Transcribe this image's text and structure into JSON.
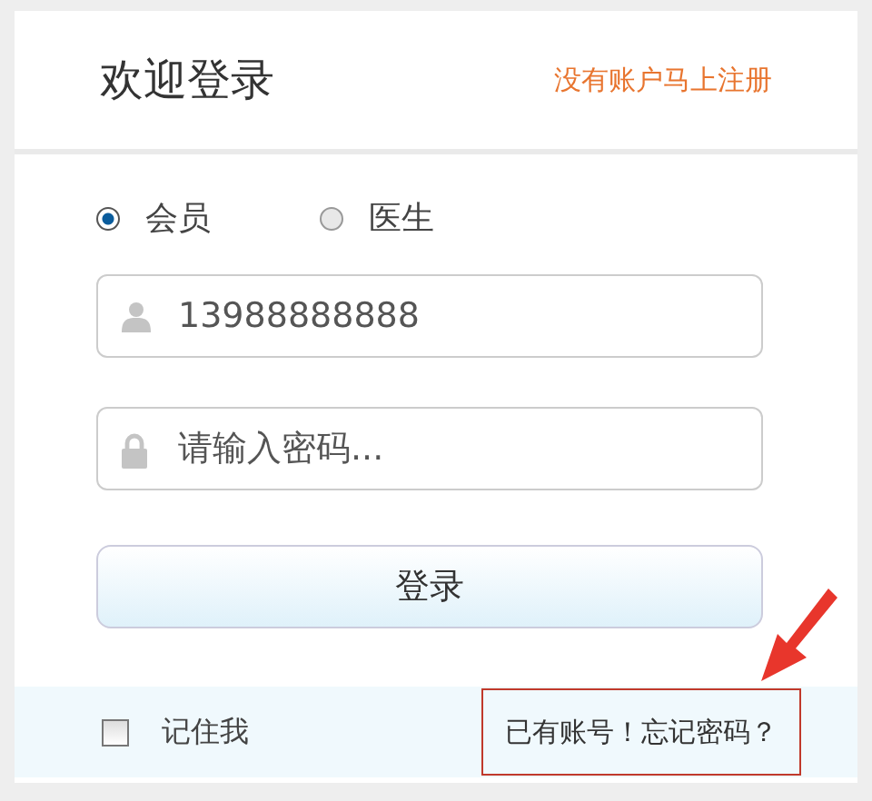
{
  "header": {
    "title": "欢迎登录",
    "register_link": "没有账户马上注册"
  },
  "roles": [
    {
      "label": "会员",
      "selected": true
    },
    {
      "label": "医生",
      "selected": false
    }
  ],
  "username": {
    "value": "13988888888"
  },
  "password": {
    "placeholder": "请输入密码..."
  },
  "login_button": "登录",
  "remember": {
    "label": "记住我",
    "checked": false
  },
  "forgot_link": "已有账号！忘记密码？"
}
